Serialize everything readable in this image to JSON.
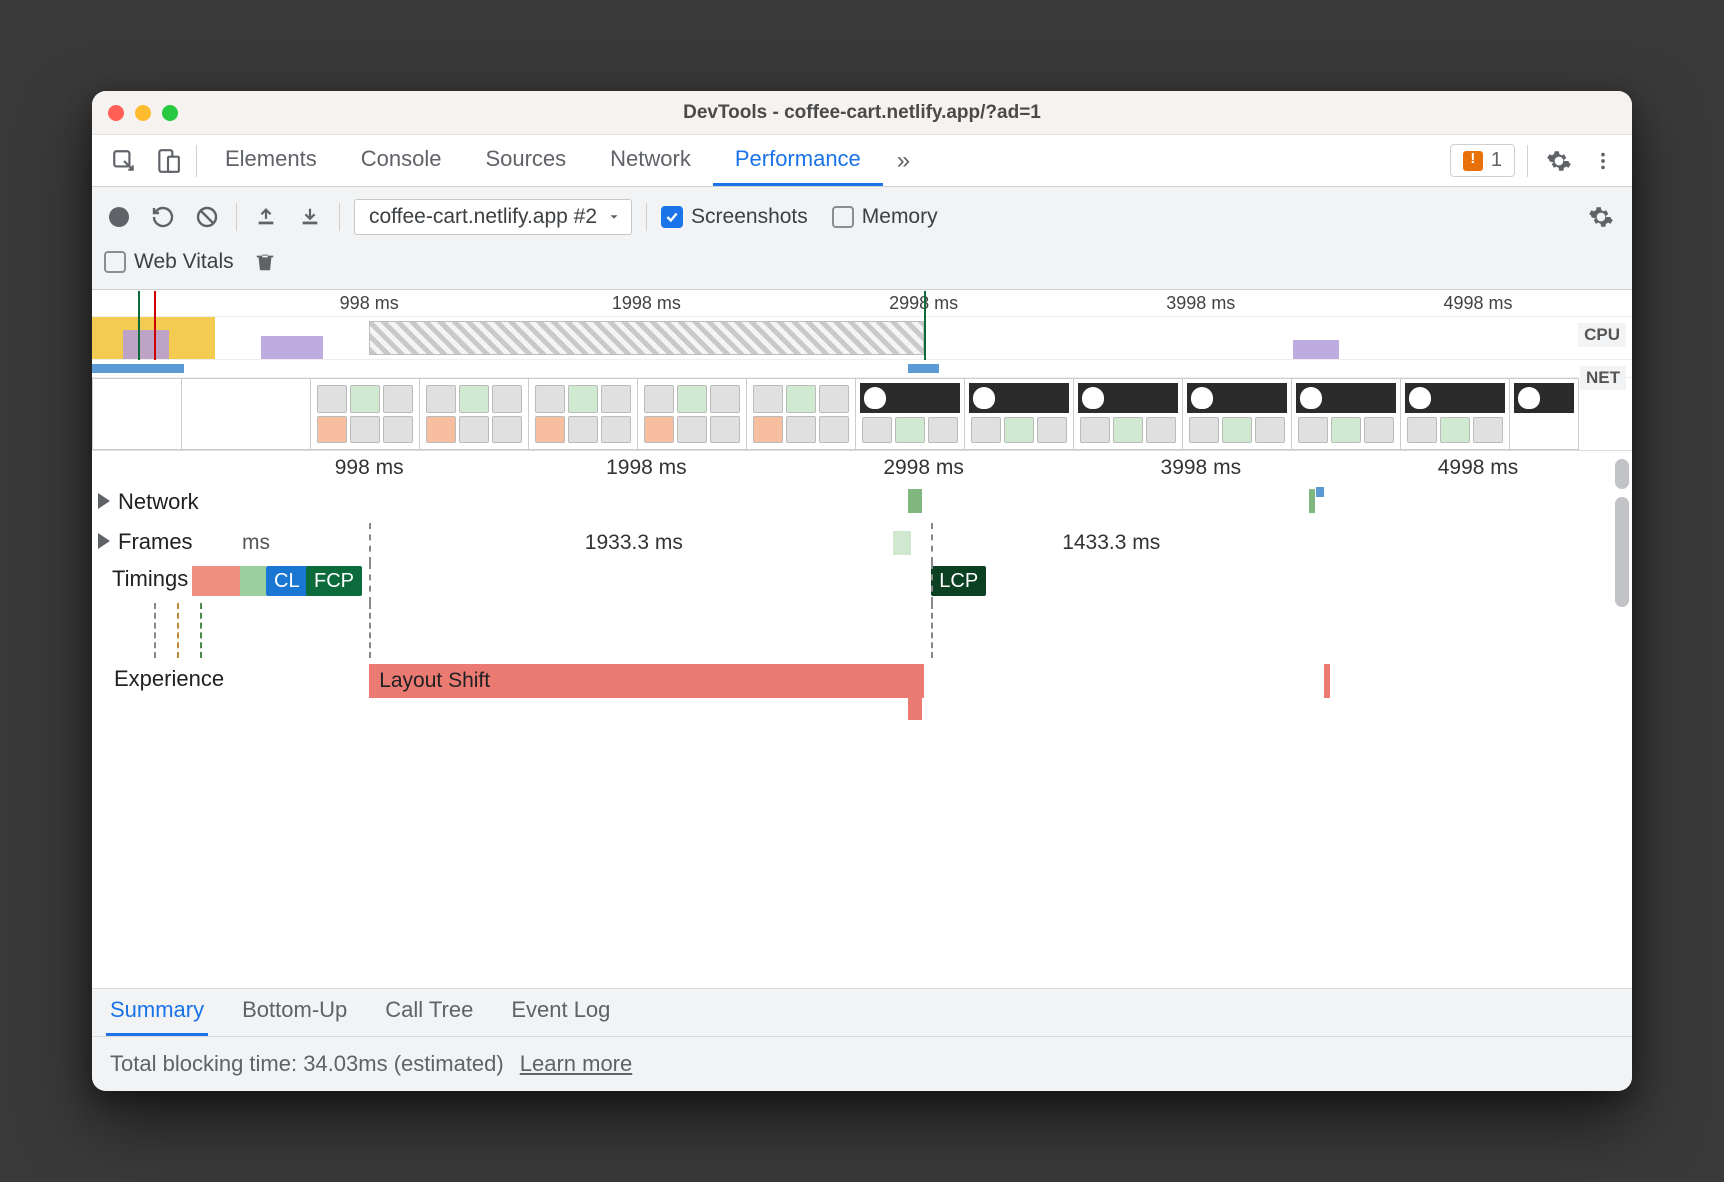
{
  "window": {
    "title": "DevTools - coffee-cart.netlify.app/?ad=1"
  },
  "tabs": {
    "items": [
      "Elements",
      "Console",
      "Sources",
      "Network",
      "Performance"
    ],
    "active": "Performance",
    "issues_count": "1"
  },
  "toolbar": {
    "recording_select": "coffee-cart.netlify.app #2",
    "screenshots_label": "Screenshots",
    "screenshots_checked": true,
    "memory_label": "Memory",
    "memory_checked": false,
    "web_vitals_label": "Web Vitals",
    "web_vitals_checked": false
  },
  "overview": {
    "ticks": [
      "998 ms",
      "1998 ms",
      "2998 ms",
      "3998 ms",
      "4998 ms"
    ],
    "cpu_label": "CPU",
    "net_label": "NET"
  },
  "flame": {
    "ticks": [
      "998 ms",
      "1998 ms",
      "2998 ms",
      "3998 ms",
      "4998 ms"
    ],
    "tracks": {
      "network": "Network",
      "frames": "Frames",
      "frames_durations": [
        "ms",
        "1933.3 ms",
        "1433.3 ms"
      ],
      "timings": "Timings",
      "timings_badges": {
        "cls": "CL",
        "fcp": "FCP",
        "lcp": "LCP"
      },
      "experience": "Experience",
      "layout_shift": "Layout Shift"
    }
  },
  "subtabs": {
    "items": [
      "Summary",
      "Bottom-Up",
      "Call Tree",
      "Event Log"
    ],
    "active": "Summary"
  },
  "status": {
    "text": "Total blocking time: 34.03ms (estimated)",
    "link": "Learn more"
  }
}
